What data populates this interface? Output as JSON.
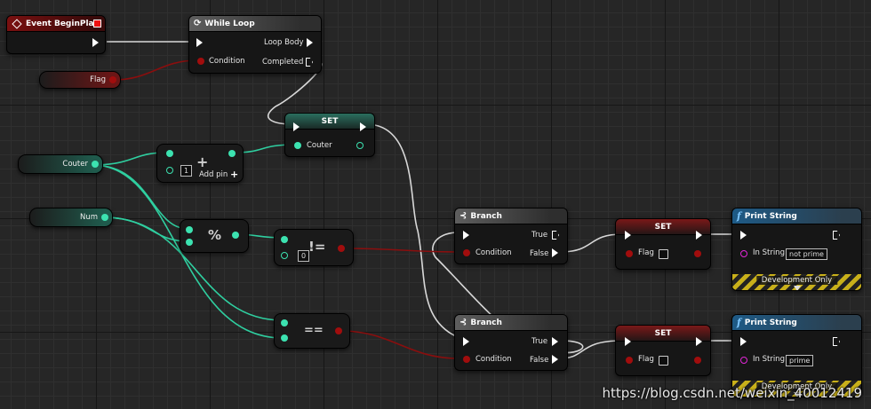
{
  "nodes": {
    "begin_play": {
      "title": "Event BeginPlay"
    },
    "while_loop": {
      "title": "While Loop",
      "condition": "Condition",
      "loop_body": "Loop Body",
      "completed": "Completed"
    },
    "flag_var": {
      "label": "Flag"
    },
    "set_top": {
      "title": "SET",
      "pin": "Couter"
    },
    "couter_var": {
      "label": "Couter"
    },
    "num_var": {
      "label": "Num"
    },
    "add_node": {
      "symbol": "+",
      "default_value": "1",
      "add_pin": "Add pin"
    },
    "mod_node": {
      "symbol": "%"
    },
    "not_equal_node": {
      "symbol": "!=",
      "default_value": "0"
    },
    "equal_node": {
      "symbol": "=="
    },
    "branch_1": {
      "title": "Branch",
      "condition": "Condition",
      "true": "True",
      "false": "False"
    },
    "branch_2": {
      "title": "Branch",
      "condition": "Condition",
      "true": "True",
      "false": "False"
    },
    "set_flag_1": {
      "title": "SET",
      "pin": "Flag"
    },
    "set_flag_2": {
      "title": "SET",
      "pin": "Flag"
    },
    "print_1": {
      "title": "Print String",
      "in_string": "In String",
      "value": "not prime",
      "dev_only": "Development Only"
    },
    "print_2": {
      "title": "Print String",
      "in_string": "In String",
      "value": "prime",
      "dev_only": "Development Only"
    }
  },
  "watermark": "https://blog.csdn.net/weixin_40012419",
  "colors": {
    "exec": "#ffffff",
    "integer": "#3ce2b0",
    "boolean": "#a10d0d",
    "string": "#e226d8"
  }
}
